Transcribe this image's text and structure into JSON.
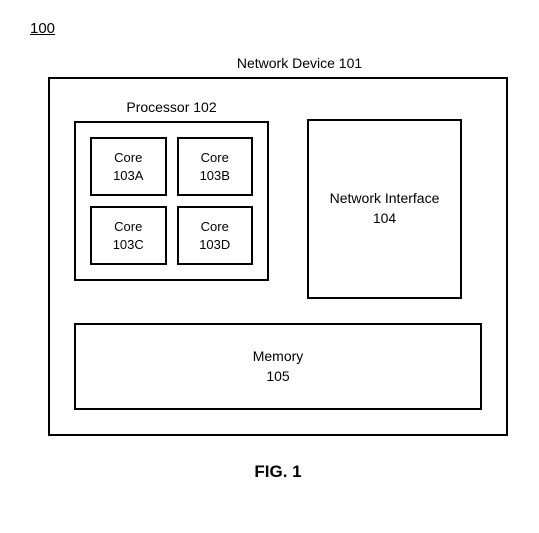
{
  "figure_ref": "100",
  "caption": "FIG. 1",
  "device": {
    "label": "Network Device 101"
  },
  "processor": {
    "label": "Processor 102",
    "cores": [
      {
        "name": "Core",
        "id": "103A"
      },
      {
        "name": "Core",
        "id": "103B"
      },
      {
        "name": "Core",
        "id": "103C"
      },
      {
        "name": "Core",
        "id": "103D"
      }
    ]
  },
  "network_interface": {
    "name": "Network Interface",
    "id": "104"
  },
  "memory": {
    "name": "Memory",
    "id": "105"
  }
}
